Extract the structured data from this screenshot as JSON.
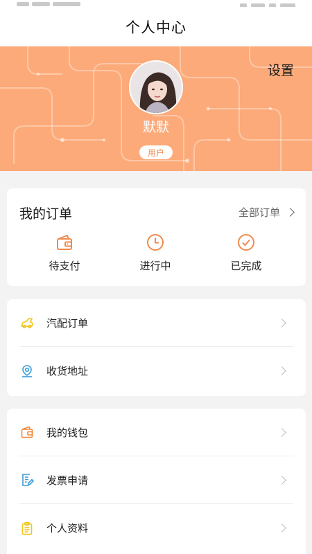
{
  "header": {
    "title": "个人中心"
  },
  "profile": {
    "settings_label": "设置",
    "username": "默默",
    "role": "用户"
  },
  "orders": {
    "title": "我的订单",
    "all_label": "全部订单",
    "items": [
      {
        "label": "待支付",
        "icon": "wallet-icon"
      },
      {
        "label": "进行中",
        "icon": "clock-icon"
      },
      {
        "label": "已完成",
        "icon": "check-circle-icon"
      }
    ]
  },
  "menu_group_1": [
    {
      "label": "汽配订单",
      "icon": "car-icon",
      "icon_color": "#f0c419"
    },
    {
      "label": "收货地址",
      "icon": "location-icon",
      "icon_color": "#3a9bd9"
    }
  ],
  "menu_group_2": [
    {
      "label": "我的钱包",
      "icon": "wallet-icon",
      "icon_color": "#f0883a"
    },
    {
      "label": "发票申请",
      "icon": "invoice-icon",
      "icon_color": "#3a9bd9"
    },
    {
      "label": "个人资料",
      "icon": "clipboard-icon",
      "icon_color": "#f0c419"
    }
  ],
  "colors": {
    "banner": "#fcaa79",
    "accent": "#f08a4b"
  }
}
